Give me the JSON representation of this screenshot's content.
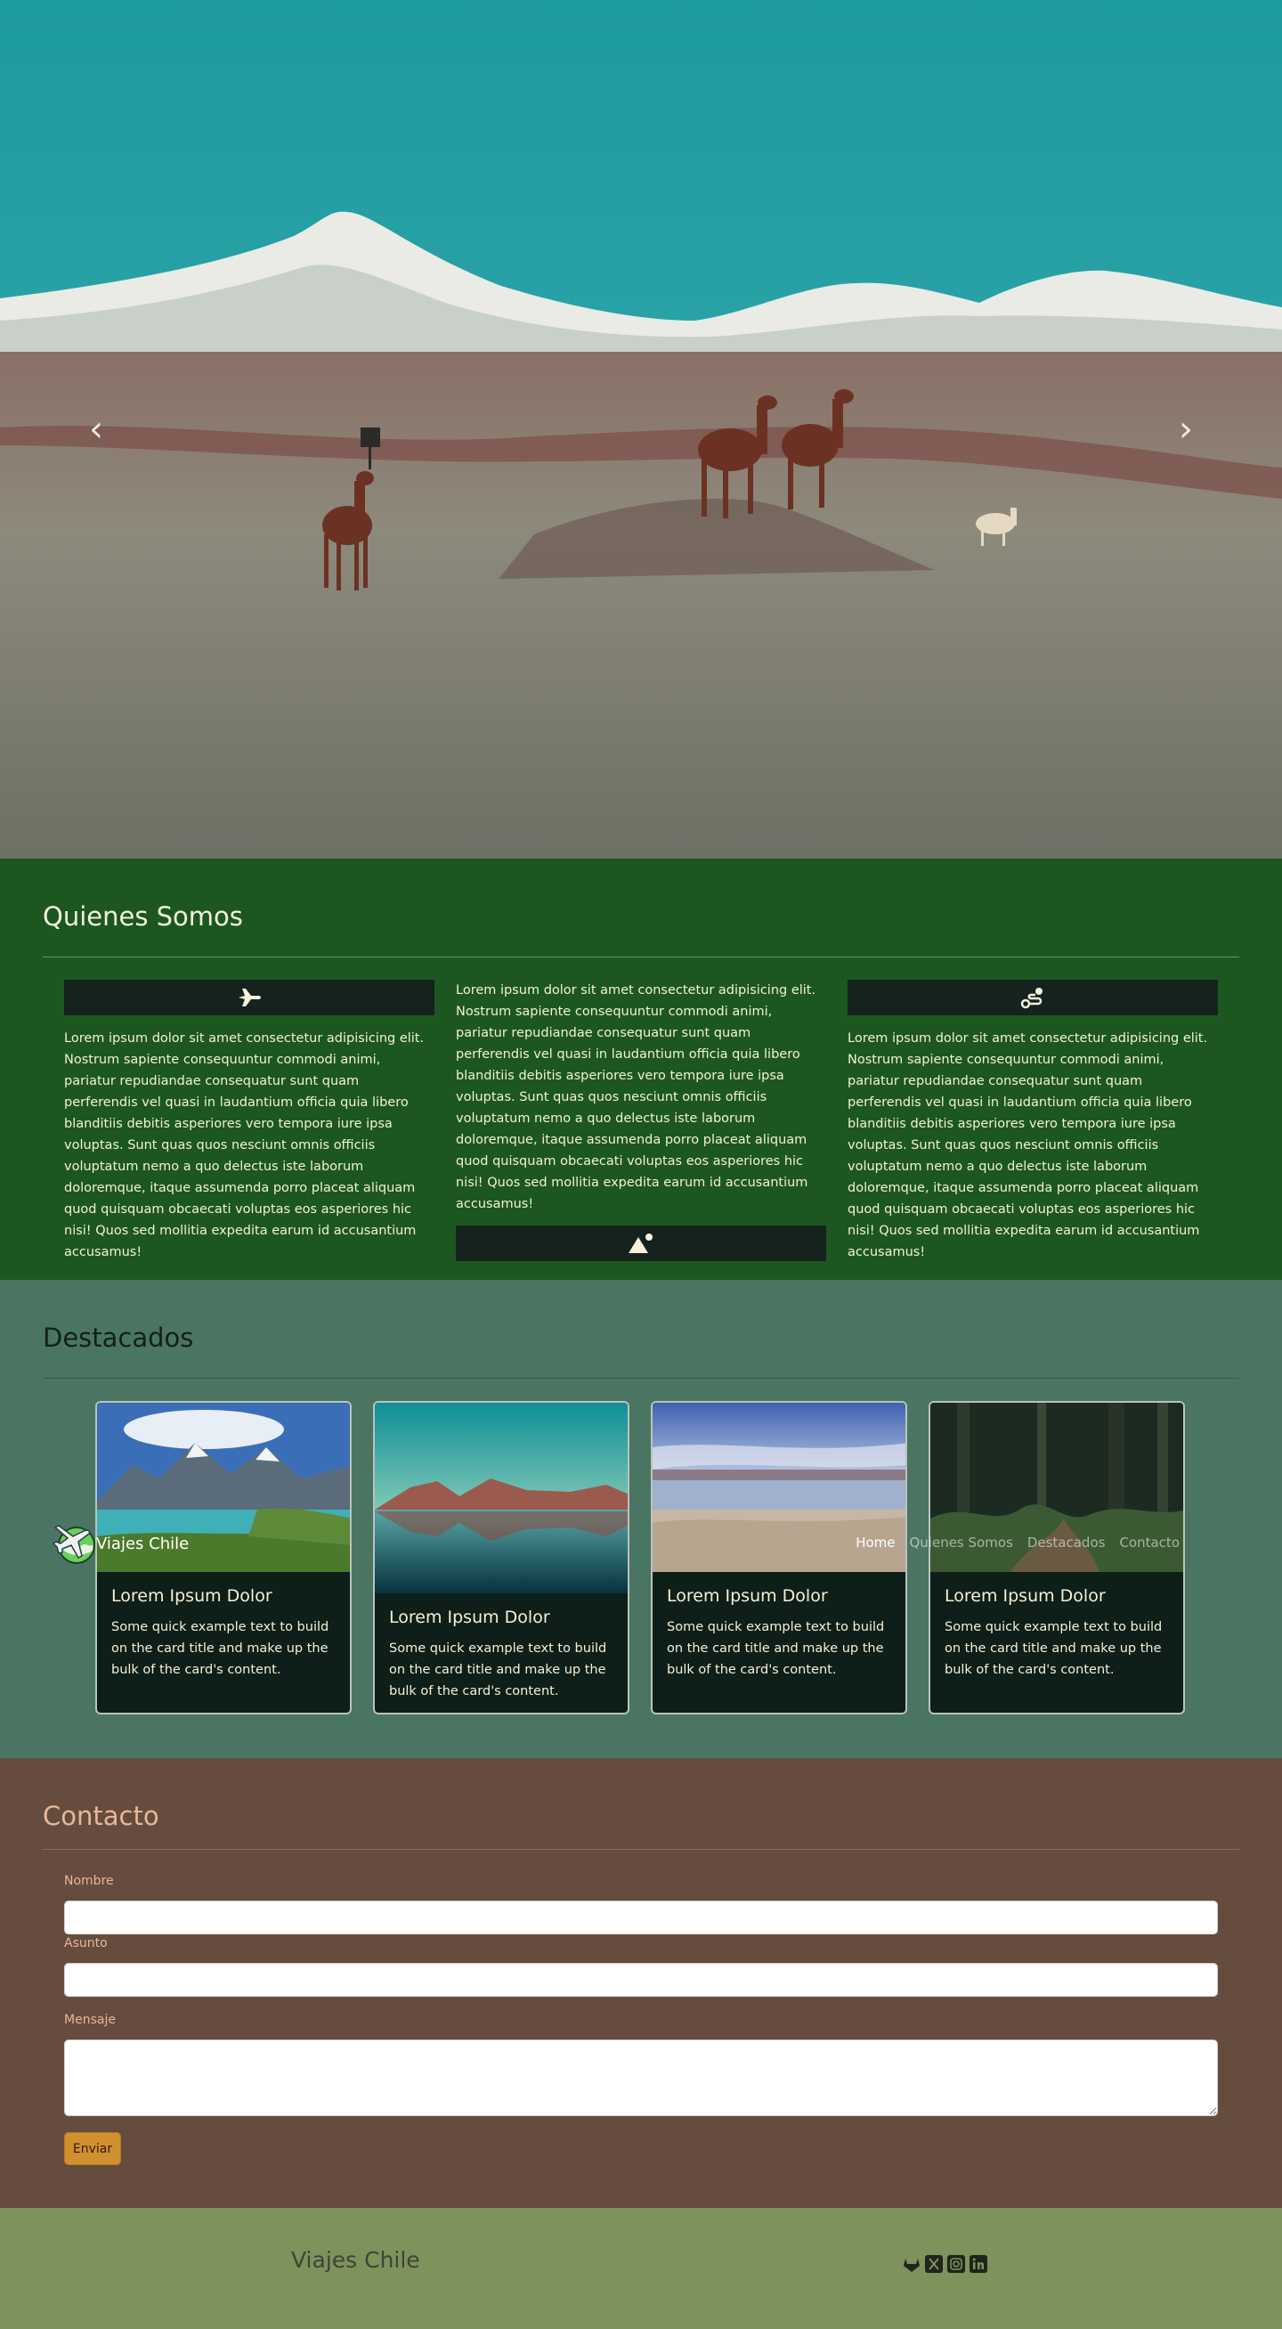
{
  "hero": {
    "prev_icon": "chevron-left-icon",
    "next_icon": "chevron-right-icon",
    "prev_glyph": "‹",
    "next_glyph": "›"
  },
  "navbar": {
    "brand": "Viajes Chile",
    "logo_icon": "airplane-globe-logo",
    "links": [
      "Home",
      "Quienes Somos",
      "Destacados",
      "Contacto"
    ],
    "active": "Home"
  },
  "quienes": {
    "title": "Quienes Somos",
    "columns": [
      {
        "icon": "airplane-icon",
        "text": "Lorem ipsum dolor sit amet consectetur adipisicing elit. Nostrum sapiente consequuntur commodi animi, pariatur repudiandae consequatur sunt quam perferendis vel quasi in laudantium officia quia libero blanditiis debitis asperiores vero tempora iure ipsa voluptas. Sunt quas quos nesciunt omnis officiis voluptatum nemo a quo delectus iste laborum doloremque, itaque assumenda porro placeat aliquam quod quisquam obcaecati voluptas eos asperiores hic nisi! Quos sed mollitia expedita earum id accusantium accusamus!"
      },
      {
        "icon": "mountain-sun-icon",
        "text": "Lorem ipsum dolor sit amet consectetur adipisicing elit. Nostrum sapiente consequuntur commodi animi, pariatur repudiandae consequatur sunt quam perferendis vel quasi in laudantium officia quia libero blanditiis debitis asperiores vero tempora iure ipsa voluptas. Sunt quas quos nesciunt omnis officiis voluptatum nemo a quo delectus iste laborum doloremque, itaque assumenda porro placeat aliquam quod quisquam obcaecati voluptas eos asperiores hic nisi! Quos sed mollitia expedita earum id accusantium accusamus!"
      },
      {
        "icon": "route-icon",
        "text": "Lorem ipsum dolor sit amet consectetur adipisicing elit. Nostrum sapiente consequuntur commodi animi, pariatur repudiandae consequatur sunt quam perferendis vel quasi in laudantium officia quia libero blanditiis debitis asperiores vero tempora iure ipsa voluptas. Sunt quas quos nesciunt omnis officiis voluptatum nemo a quo delectus iste laborum doloremque, itaque assumenda porro placeat aliquam quod quisquam obcaecati voluptas eos asperiores hic nisi! Quos sed mollitia expedita earum id accusantium accusamus!"
      }
    ]
  },
  "destacados": {
    "title": "Destacados",
    "cards": [
      {
        "title": "Lorem Ipsum Dolor",
        "text": "Some quick example text to build on the card title and make up the bulk of the card's content."
      },
      {
        "title": "Lorem Ipsum Dolor",
        "text": "Some quick example text to build on the card title and make up the bulk of the card's content."
      },
      {
        "title": "Lorem Ipsum Dolor",
        "text": "Some quick example text to build on the card title and make up the bulk of the card's content."
      },
      {
        "title": "Lorem Ipsum Dolor",
        "text": "Some quick example text to build on the card title and make up the bulk of the card's content."
      }
    ]
  },
  "contacto": {
    "title": "Contacto",
    "fields": {
      "nombre": "Nombre",
      "asunto": "Asunto",
      "mensaje": "Mensaje"
    },
    "submit": "Enviar"
  },
  "footer": {
    "brand": "Viajes Chile",
    "social": [
      "gitlab-icon",
      "x-icon",
      "instagram-icon",
      "linkedin-icon"
    ]
  },
  "colors": {
    "quienes_bg": "#1c5720",
    "destacados_bg": "#4a7563",
    "contacto_bg": "#654c3e",
    "footer_bg": "#7e925c",
    "accent": "#d1902e"
  }
}
